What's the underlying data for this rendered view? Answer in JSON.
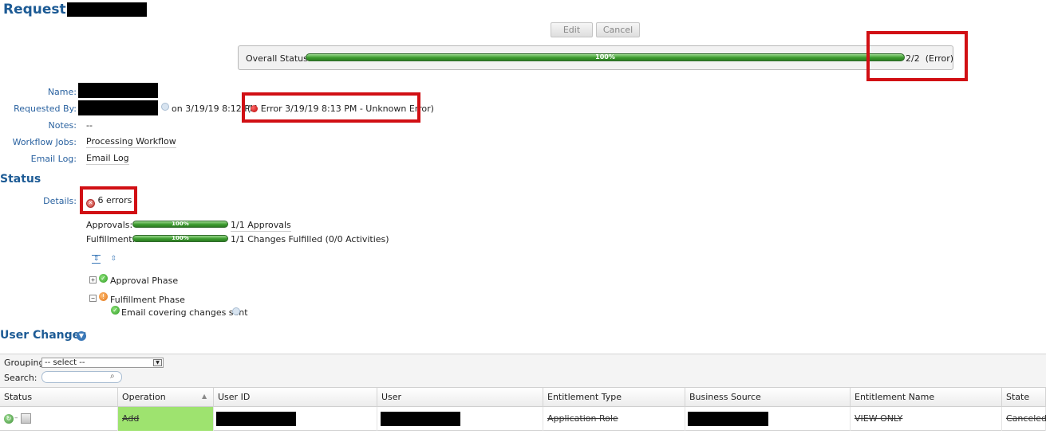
{
  "header": {
    "title": "Request:",
    "edit_label": "Edit",
    "cancel_label": "Cancel"
  },
  "overall_status": {
    "label": "Overall Status:",
    "progress_percent": 100,
    "progress_label": "100%",
    "count_text": "2/2",
    "state_text": "(Error)"
  },
  "details": {
    "name_label": "Name:",
    "requested_by_label": "Requested By:",
    "requested_on_text": "on 3/19/19 8:12 PM",
    "requested_error_text": "Error 3/19/19 8:13 PM - Unknown Error)",
    "requested_open_paren": "(",
    "notes_label": "Notes:",
    "notes_value": "--",
    "workflow_jobs_label": "Workflow Jobs:",
    "workflow_jobs_value": "Processing Workflow",
    "email_log_label": "Email Log:",
    "email_log_value": "Email Log"
  },
  "status_section": {
    "title": "Status",
    "details_label": "Details:",
    "errors_text": "6 errors",
    "approvals_label": "Approvals:",
    "approvals_percent": 100,
    "approvals_bar_label": "100%",
    "approvals_text": "1/1 Approvals",
    "fulfillment_label": "Fulfillment:",
    "fulfillment_percent": 100,
    "fulfillment_bar_label": "100%",
    "fulfillment_text": "1/1 Changes Fulfilled (0/0 Activities)",
    "approval_phase": "Approval Phase",
    "fulfillment_phase": "Fulfillment Phase",
    "email_sent": "Email covering changes sent"
  },
  "user_changes": {
    "title": "User Changes",
    "grouping_label": "Grouping:",
    "grouping_value": "-- select --",
    "search_label": "Search:",
    "search_value": "",
    "columns": [
      "Status",
      "Operation",
      "User ID",
      "User",
      "Entitlement Type",
      "Business Source",
      "Entitlement Name",
      "State"
    ],
    "rows": [
      {
        "operation": "Add",
        "entitlement_type": "Application Role",
        "entitlement_name": "VIEW ONLY",
        "state": "Canceled"
      }
    ]
  },
  "colors": {
    "heading": "#1d5b95",
    "label": "#2a62a0",
    "progress_green": "#3c9a2e",
    "highlight_red": "#d10f14",
    "operation_add_bg": "#9ee36f"
  }
}
